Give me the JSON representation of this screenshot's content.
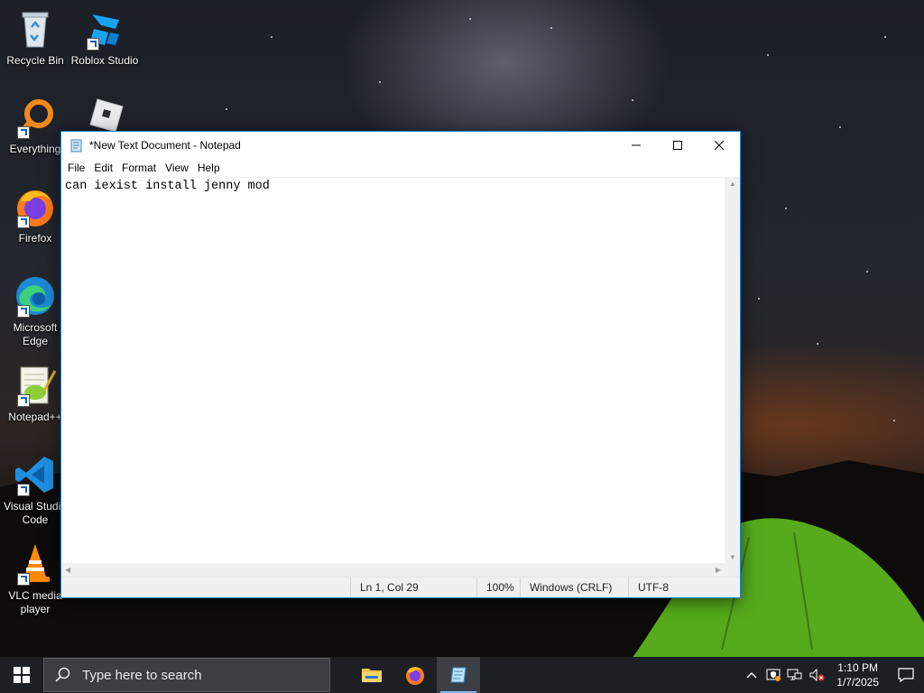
{
  "desktop": {
    "icons": [
      {
        "label": "Recycle Bin",
        "icon": "recycle-bin-icon"
      },
      {
        "label": "Roblox Studio",
        "icon": "roblox-studio-icon"
      },
      {
        "label": "Everything",
        "icon": "everything-search-icon"
      },
      {
        "label": "Firefox",
        "icon": "firefox-icon"
      },
      {
        "label": "Microsoft Edge",
        "icon": "edge-icon"
      },
      {
        "label": "Notepad++",
        "icon": "notepadpp-icon"
      },
      {
        "label": "Visual Studio Code",
        "icon": "vscode-icon"
      },
      {
        "label": "VLC media player",
        "icon": "vlc-icon"
      }
    ]
  },
  "notepad": {
    "title": "*New Text Document - Notepad",
    "menu": [
      "File",
      "Edit",
      "Format",
      "View",
      "Help"
    ],
    "content": "can iexist install jenny mod",
    "status": {
      "position": "Ln 1, Col 29",
      "zoom": "100%",
      "line_ending": "Windows (CRLF)",
      "encoding": "UTF-8"
    }
  },
  "taskbar": {
    "search_placeholder": "Type here to search",
    "apps": [
      "file-explorer-icon",
      "firefox-icon",
      "notepad-icon"
    ],
    "clock": {
      "time": "1:10 PM",
      "date": "1/7/2025"
    },
    "tray_icons": [
      "chevron-up-icon",
      "security-icon",
      "network-icon",
      "volume-muted-icon"
    ]
  },
  "colors": {
    "window_border": "#1883d7",
    "taskbar_bg": "#1c2024",
    "active_indicator": "#7fb8ef"
  }
}
